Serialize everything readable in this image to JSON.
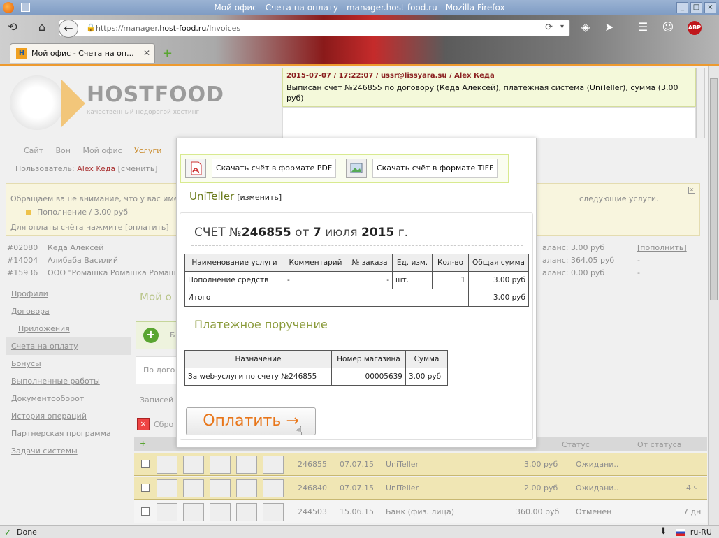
{
  "window": {
    "title": "Мой офис - Счета на оплату - manager.host-food.ru - Mozilla Firefox"
  },
  "browser": {
    "url_prefix": "https://manager.",
    "url_domain": "host-food.ru",
    "url_path": "/Invoices",
    "tab_label": "Мой офис - Счета на оп...",
    "tab_favicon": "H",
    "adblock": "ABP"
  },
  "site": {
    "logo_host": "HOST",
    "logo_food": "FOOD",
    "logo_tagline": "качественный недорогой хостинг",
    "menu": [
      "Сайт",
      "Вон",
      "Мой офис",
      "Услуги"
    ],
    "user_label": "Пользователь:",
    "user_name": "Alex Keда",
    "user_change": "[сменить]"
  },
  "notice": {
    "text_left": "Обращаем ваше внимание, что у вас име",
    "text_right": "следующие услуги.",
    "item": "Пополнение / 3.00 руб",
    "pay_text": "Для оплаты счёта нажмите",
    "pay_link": "[оплатить]"
  },
  "accounts": [
    {
      "id": "#02080",
      "name": "Кеда Алексей",
      "balance": "аланс: 3.00 руб",
      "action": "[пополнить]"
    },
    {
      "id": "#14004",
      "name": "Алибаба Василий",
      "balance": "аланс: 364.05 руб",
      "action": "-"
    },
    {
      "id": "#15936",
      "name": "ООО \"Ромашка Ромашка Ромашк",
      "balance": "аланс: 0.00 руб",
      "action": "-"
    }
  ],
  "sidebar": {
    "items": [
      "Профили",
      "Договора",
      "Приложения",
      "Счета на оплату",
      "Бонусы",
      "Выполненные работы",
      "Документооборот",
      "История операций",
      "Партнерская программа",
      "Задачи системы"
    ]
  },
  "main": {
    "title": "Мой о",
    "green_letter": "Б",
    "box_text": "По дого",
    "filter_text": "Записей",
    "reset_text": "Сбро",
    "col_status": "Статус",
    "col_from_status": "От статуса"
  },
  "invoice_rows": [
    {
      "num": "246855",
      "date": "07.07.15",
      "system": "UniTeller",
      "sum": "3.00 руб",
      "status": "Ожидани..",
      "age": ""
    },
    {
      "num": "246840",
      "date": "07.07.15",
      "system": "UniTeller",
      "sum": "2.00 руб",
      "status": "Ожидани..",
      "age": "4 ч"
    },
    {
      "num": "244503",
      "date": "15.06.15",
      "system": "Банк (физ. лица)",
      "sum": "360.00 руб",
      "status": "Отменен",
      "age": "7 дн"
    }
  ],
  "log": {
    "header": "2015-07-07 / 17:22:07 / ussr@lissyara.su / Alex Кеда",
    "body": "Выписан счёт №246855 по договору (Кеда Алексей), платежная система (UniTeller), сумма (3.00 руб)"
  },
  "dialog": {
    "pdf_label": "Скачать счёт в формате PDF",
    "tiff_label": "Скачать счёт в формате TIFF",
    "pay_system": "UniTeller",
    "change_link": "[изменить]",
    "invoice_prefix": "СЧЕТ №",
    "invoice_number": "246855",
    "invoice_from": "от",
    "invoice_day": "7",
    "invoice_month": "июля",
    "invoice_year": "2015",
    "invoice_suffix": "г.",
    "table_headers": [
      "Наименование услуги",
      "Комментарий",
      "№ заказа",
      "Ед. изм.",
      "Кол-во",
      "Общая сумма"
    ],
    "table_row": [
      "Пополнение средств",
      "-",
      "-",
      "шт.",
      "1",
      "3.00 руб"
    ],
    "total_label": "Итого",
    "total_value": "3.00 руб",
    "payment_order_title": "Платежное поручение",
    "order_headers": [
      "Назначение",
      "Номер магазина",
      "Сумма"
    ],
    "order_row": [
      "За web-услуги по счету №246855",
      "00005639",
      "3.00 руб"
    ],
    "pay_button": "Оплатить →"
  },
  "statusbar": {
    "text": "Done",
    "lang": "ru-RU"
  }
}
